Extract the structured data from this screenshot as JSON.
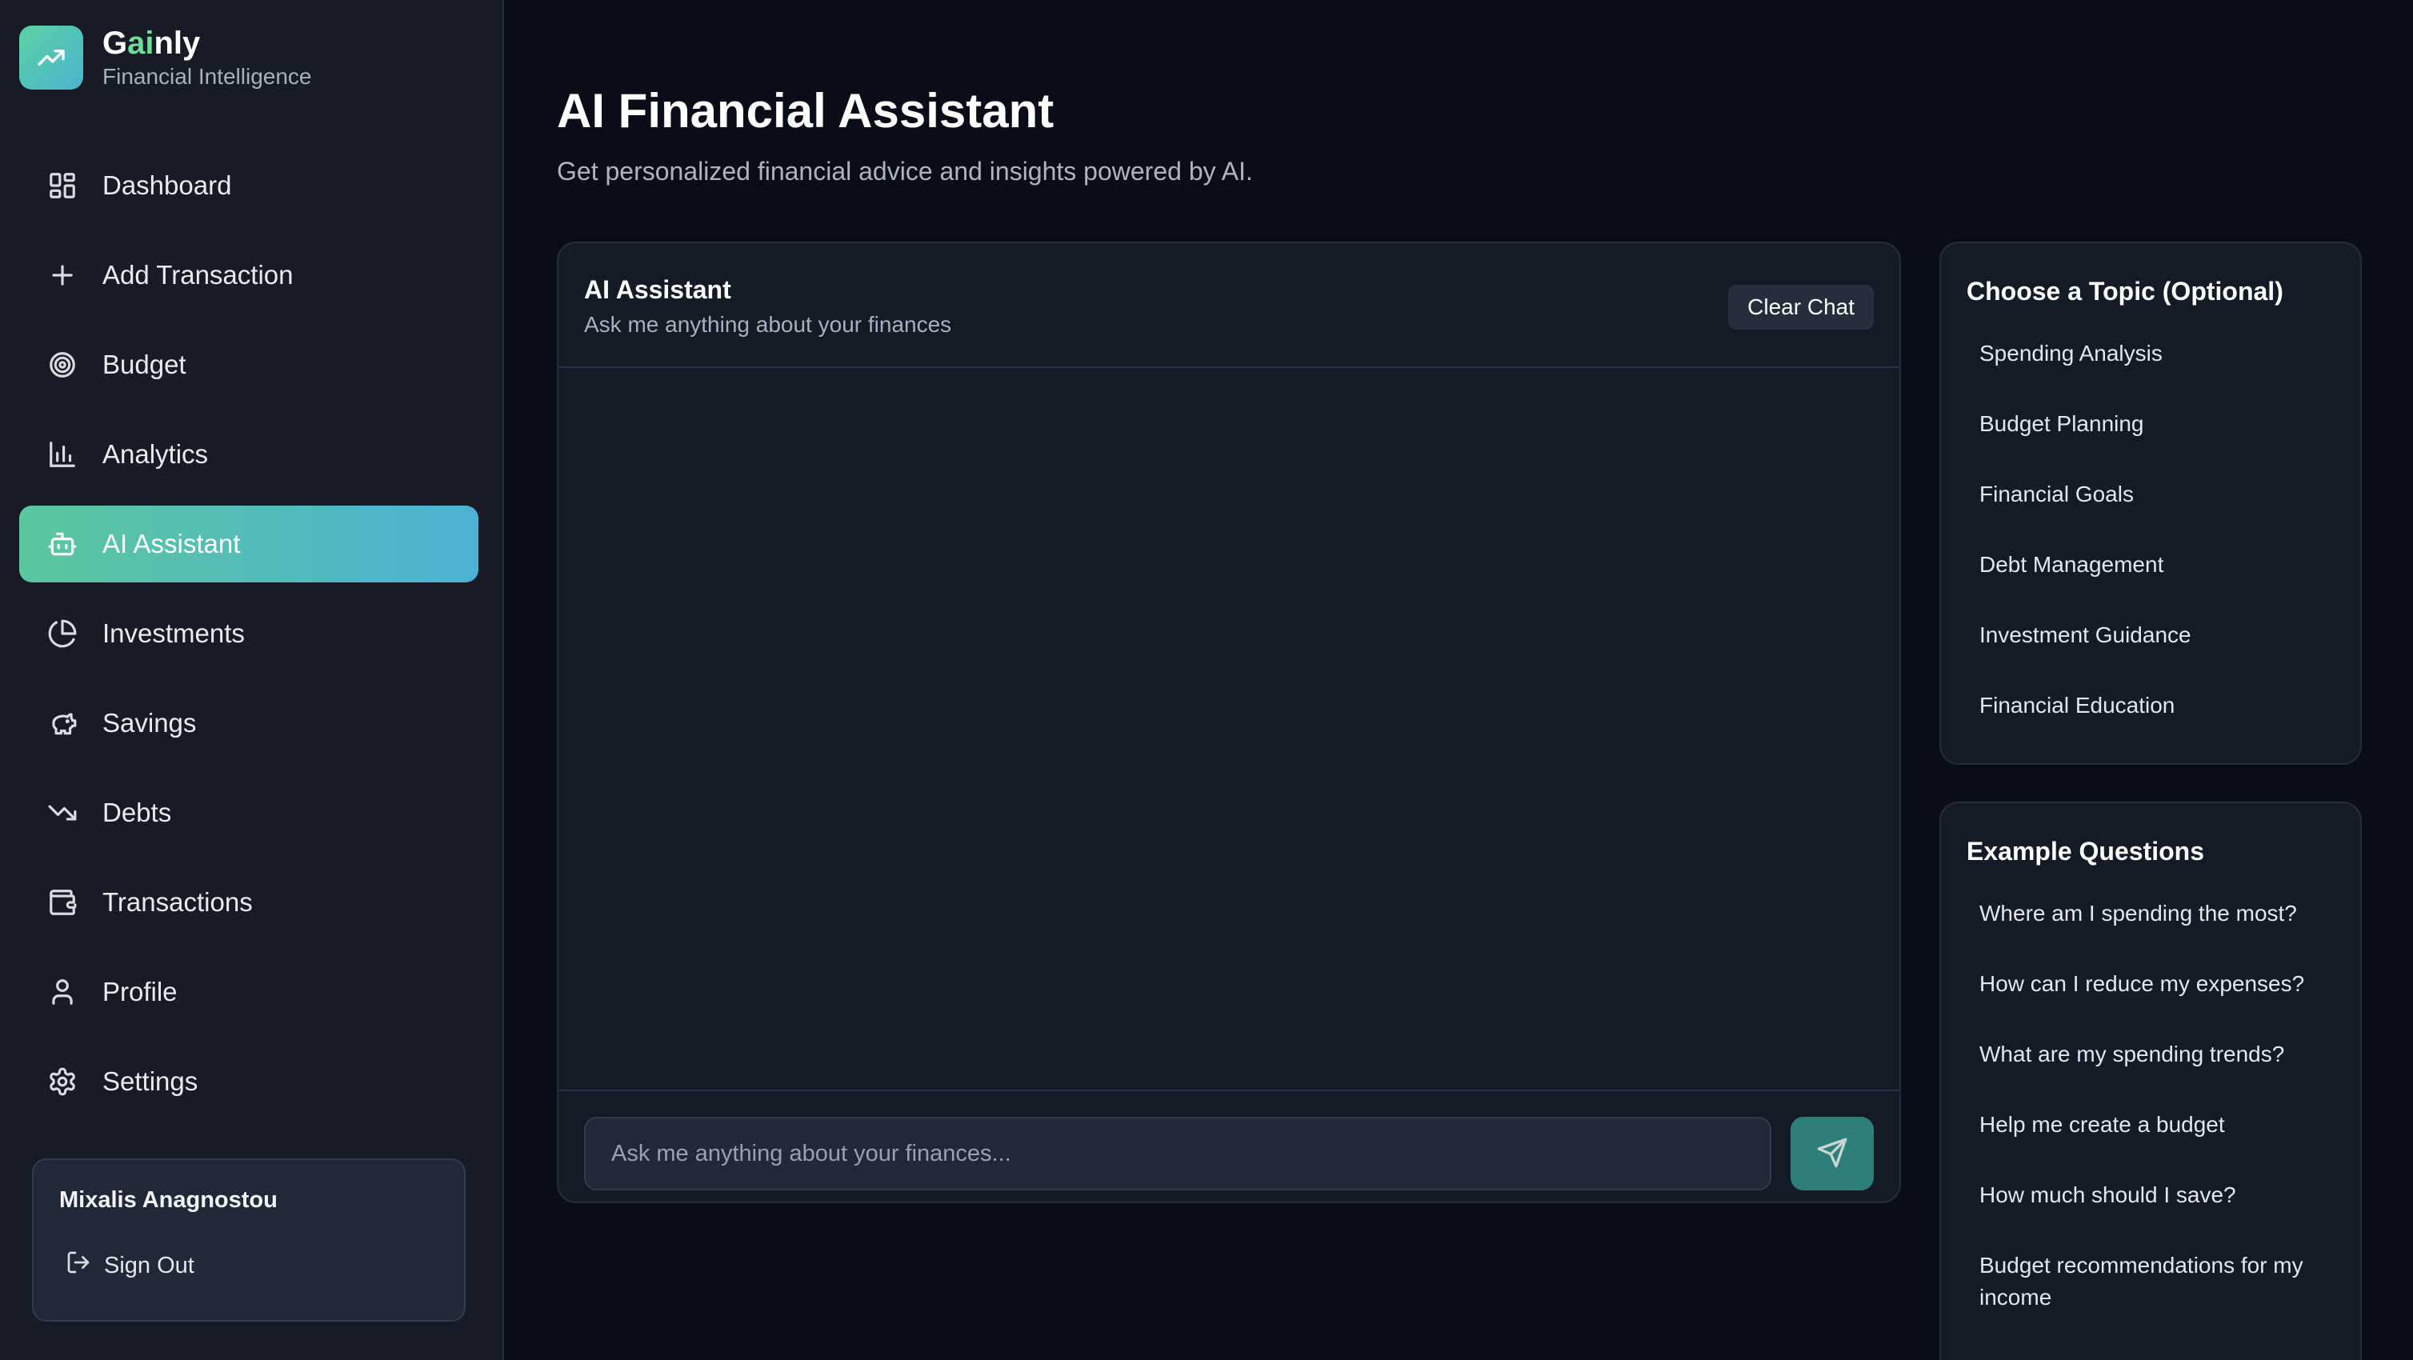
{
  "brand": {
    "name_prefix": "G",
    "name_accent": "ai",
    "name_suffix": "nly",
    "subtitle": "Financial Intelligence",
    "logo_icon": "trending-up-icon"
  },
  "sidebar": {
    "items": [
      {
        "label": "Dashboard",
        "icon": "layout-grid-icon",
        "active": false
      },
      {
        "label": "Add Transaction",
        "icon": "plus-icon",
        "active": false
      },
      {
        "label": "Budget",
        "icon": "target-icon",
        "active": false
      },
      {
        "label": "Analytics",
        "icon": "bar-chart-icon",
        "active": false
      },
      {
        "label": "AI Assistant",
        "icon": "bot-icon",
        "active": true
      },
      {
        "label": "Investments",
        "icon": "pie-chart-icon",
        "active": false
      },
      {
        "label": "Savings",
        "icon": "piggy-bank-icon",
        "active": false
      },
      {
        "label": "Debts",
        "icon": "trending-down-icon",
        "active": false
      },
      {
        "label": "Transactions",
        "icon": "wallet-icon",
        "active": false
      },
      {
        "label": "Profile",
        "icon": "user-icon",
        "active": false
      },
      {
        "label": "Settings",
        "icon": "gear-icon",
        "active": false
      }
    ]
  },
  "user": {
    "name": "Mixalis Anagnostou",
    "signout_label": "Sign Out"
  },
  "main": {
    "title": "AI Financial Assistant",
    "subtitle": "Get personalized financial advice and insights powered by AI."
  },
  "chat": {
    "title": "AI Assistant",
    "subtitle": "Ask me anything about your finances",
    "clear_label": "Clear Chat",
    "input_placeholder": "Ask me anything about your finances...",
    "input_value": ""
  },
  "topics": {
    "title": "Choose a Topic (Optional)",
    "items": [
      "Spending Analysis",
      "Budget Planning",
      "Financial Goals",
      "Debt Management",
      "Investment Guidance",
      "Financial Education"
    ]
  },
  "examples": {
    "title": "Example Questions",
    "items": [
      "Where am I spending the most?",
      "How can I reduce my expenses?",
      "What are my spending trends?",
      "Help me create a budget",
      "How much should I save?",
      "Budget recommendations for my income"
    ]
  },
  "colors": {
    "accent_start": "#5bc79e",
    "accent_end": "#4bb2d2",
    "background": "#0a0d17",
    "sidebar": "#161b26",
    "send_button": "#2e7f78"
  }
}
